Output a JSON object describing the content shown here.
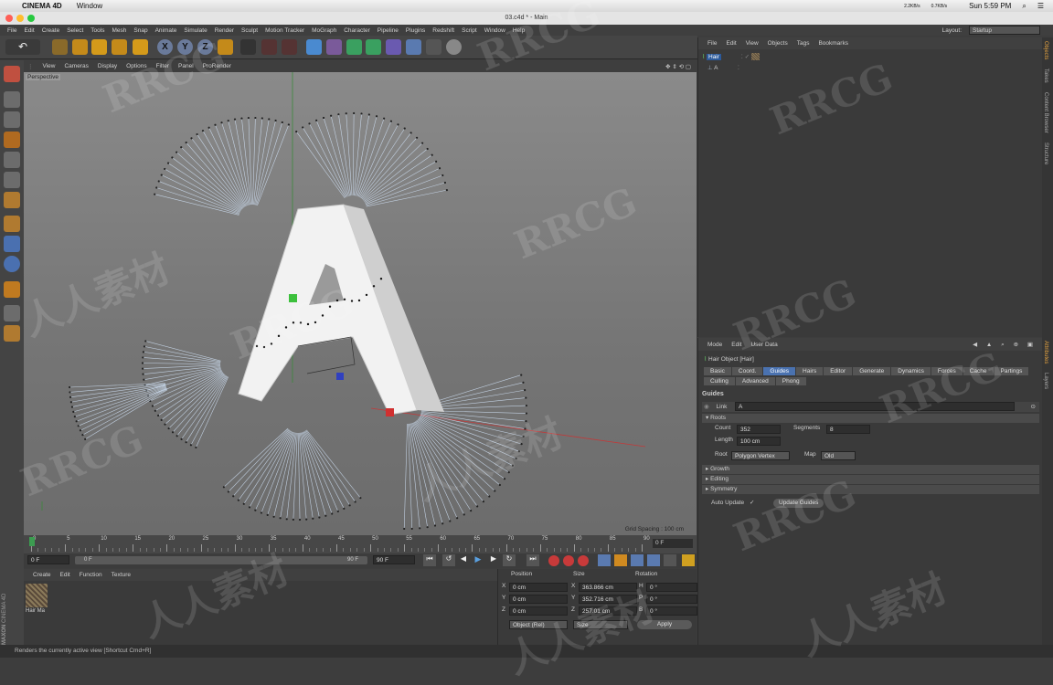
{
  "mac_menubar": {
    "app_name": "CINEMA 4D",
    "menu": "Window",
    "clock": "Sun 5:59 PM",
    "net_up": "2.2KB/s",
    "net_down": "0.7KB/s"
  },
  "window": {
    "title": "03.c4d * - Main"
  },
  "menubar": [
    "File",
    "Edit",
    "Create",
    "Select",
    "Tools",
    "Mesh",
    "Snap",
    "Animate",
    "Simulate",
    "Render",
    "Sculpt",
    "Motion Tracker",
    "MoGraph",
    "Character",
    "Pipeline",
    "Plugins",
    "Redshift",
    "Script",
    "Window",
    "Help"
  ],
  "layout": {
    "label": "Layout:",
    "value": "Startup"
  },
  "viewport_menu": [
    "View",
    "Cameras",
    "Display",
    "Options",
    "Filter",
    "Panel",
    "ProRender"
  ],
  "viewport": {
    "camera_label": "Perspective",
    "grid_spacing": "Grid Spacing : 100 cm"
  },
  "object_manager": {
    "menu": [
      "File",
      "Edit",
      "View",
      "Objects",
      "Tags",
      "Bookmarks"
    ],
    "objects": [
      {
        "name": "Hair"
      },
      {
        "name": "A"
      }
    ]
  },
  "right_tabs": [
    "Objects",
    "Takes",
    "Content Browser",
    "Structure"
  ],
  "right_tabs_lower": [
    "Attributes",
    "Layers"
  ],
  "attributes": {
    "menu": [
      "Mode",
      "Edit",
      "User Data"
    ],
    "object_title": "Hair Object [Hair]",
    "tabs_row1": [
      "Basic",
      "Coord.",
      "Guides",
      "Hairs",
      "Editor",
      "Generate",
      "Dynamics",
      "Forces",
      "Cache",
      "Partings"
    ],
    "tabs_row2": [
      "Culling",
      "Advanced",
      "Phong"
    ],
    "active_tab": "Guides",
    "section_title": "Guides",
    "link_label": "Link",
    "link_value": "A",
    "roots_section": "Roots",
    "count_label": "Count",
    "count_value": "352",
    "segments_label": "Segments",
    "segments_value": "8",
    "length_label": "Length",
    "length_value": "100 cm",
    "root_label": "Root",
    "root_value": "Polygon Vertex",
    "map_label": "Map",
    "map_value": "Old",
    "collapsed_sections": [
      "Growth",
      "Editing",
      "Symmetry"
    ],
    "auto_update_label": "Auto Update",
    "auto_update_check": "✓",
    "update_guides_button": "Update Guides"
  },
  "timeline": {
    "ticks": [
      "0",
      "5",
      "10",
      "15",
      "20",
      "25",
      "30",
      "35",
      "40",
      "45",
      "50",
      "55",
      "60",
      "65",
      "70",
      "75",
      "80",
      "85",
      "90"
    ],
    "current_frame_field": "0 F",
    "start_field": "0 F",
    "range_start": "0 F",
    "range_end": "90 F",
    "end_field": "90 F"
  },
  "material_manager": {
    "menu": [
      "Create",
      "Edit",
      "Function",
      "Texture"
    ],
    "materials": [
      {
        "name": "Hair Ma"
      }
    ]
  },
  "coordinates": {
    "headers": [
      "Position",
      "Size",
      "Rotation"
    ],
    "rows": [
      {
        "axis": "X",
        "pos": "0 cm",
        "size_axis": "X",
        "size": "363.866 cm",
        "rot_axis": "H",
        "rot": "0 °"
      },
      {
        "axis": "Y",
        "pos": "0 cm",
        "size_axis": "Y",
        "size": "352.716 cm",
        "rot_axis": "P",
        "rot": "0 °"
      },
      {
        "axis": "Z",
        "pos": "0 cm",
        "size_axis": "Z",
        "size": "257.01 cm",
        "rot_axis": "B",
        "rot": "0 °"
      }
    ],
    "mode_select": "Object (Rel)",
    "size_select": "Size",
    "apply_button": "Apply"
  },
  "statusbar": {
    "text": "Renders the currently active view [Shortcut Cmd+R]"
  },
  "brand": {
    "maxon": "MAXON",
    "c4d": "CINEMA 4D"
  },
  "watermark": {
    "text": "RRCG",
    "cn": "人人素材"
  },
  "colors": {
    "accent": "#4a72b0",
    "bg": "#3d3d3d",
    "viewport": "#7f7f7f"
  }
}
